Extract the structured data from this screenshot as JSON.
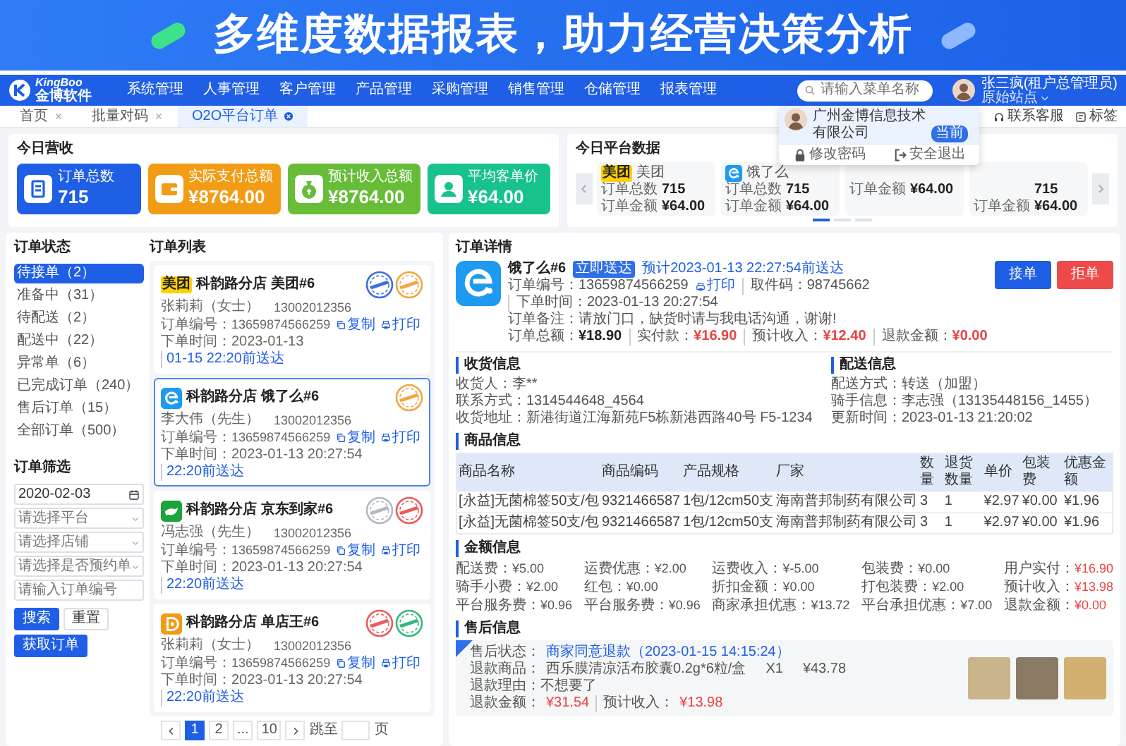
{
  "banner": {
    "title": "多维度数据报表，助力经营决策分析"
  },
  "nav": {
    "logo_name": "KingBoo",
    "logo_subtitle": "金博软件",
    "menus": [
      "系统管理",
      "人事管理",
      "客户管理",
      "产品管理",
      "采购管理",
      "销售管理",
      "仓储管理",
      "报表管理"
    ],
    "search": {
      "placeholder": "请输入菜单名称"
    },
    "user": {
      "name": "张三疯(租户总管理员)",
      "store": "原始站点"
    }
  },
  "tabs": [
    {
      "label": "首页",
      "selected": false
    },
    {
      "label": "批量对码",
      "selected": false
    },
    {
      "label": "O2O平台订单",
      "selected": true
    }
  ],
  "links": [
    {
      "kind": "service",
      "label": "联系客服"
    },
    {
      "kind": "tag",
      "label": "标签"
    }
  ],
  "user_menu": {
    "company": "广州金博信息技术有限公司",
    "badge": "当前",
    "actions": [
      {
        "kind": "password",
        "label": "修改密码"
      },
      {
        "kind": "logout",
        "label": "安全退出"
      }
    ]
  },
  "revenue": {
    "title": "今日营收",
    "cards": [
      {
        "kind": "orders",
        "label": "订单总数",
        "value": "715",
        "color": "#1f5fe6"
      },
      {
        "kind": "paid",
        "label": "实际支付总额",
        "value": "¥8764.00",
        "color": "#f29b14"
      },
      {
        "kind": "income",
        "label": "预计收入总额",
        "value": "¥8764.00",
        "color": "#67bd38"
      },
      {
        "kind": "average",
        "label": "平均客单价",
        "value": "¥64.00",
        "color": "#18c28c"
      }
    ]
  },
  "platforms": {
    "title": "今日平台数据",
    "cards": [
      {
        "kind": "meituan",
        "logo_text": "美团",
        "name": "美团",
        "count_label": "订单总数",
        "count": "715",
        "amount_label": "订单金额",
        "amount": "¥64.00"
      },
      {
        "kind": "eleme",
        "name": "饿了么",
        "count_label": "订单总数",
        "count": "715",
        "amount_label": "订单金额",
        "amount": "¥64.00"
      },
      {
        "amount_label": "订单金额",
        "amount": "¥64.00"
      },
      {
        "count": "715",
        "amount_label": "订单金额",
        "amount": "¥64.00"
      }
    ],
    "pages": [
      {
        "selected": true
      },
      {
        "selected": false
      },
      {
        "selected": false
      }
    ]
  },
  "order_status": {
    "title": "订单状态",
    "items": [
      {
        "label": "待接单（2）",
        "selected": true
      },
      {
        "label": "准备中（31）",
        "selected": false
      },
      {
        "label": "待配送（2）",
        "selected": false
      },
      {
        "label": "配送中（22）",
        "selected": false
      },
      {
        "label": "异常单（6）",
        "selected": false
      },
      {
        "label": "已完成订单（240）",
        "selected": false
      },
      {
        "label": "售后订单（15）",
        "selected": false
      },
      {
        "label": "全部订单（500）",
        "selected": false
      }
    ]
  },
  "filter": {
    "title": "订单筛选",
    "date": {
      "value": "2020-02-03"
    },
    "selects": [
      {
        "placeholder": "请选择平台"
      },
      {
        "placeholder": "请选择店铺"
      },
      {
        "placeholder": "请选择是否预约单"
      }
    ],
    "order_no": {
      "placeholder": "请输入订单编号"
    },
    "buttons": [
      {
        "kind": "primary",
        "label": "搜索"
      },
      {
        "kind": "plain",
        "label": "重置"
      },
      {
        "kind": "primary",
        "label": "获取订单"
      }
    ]
  },
  "orders": {
    "title": "订单列表",
    "items": [
      {
        "kind": "meituan",
        "logo_text": "美团",
        "store": "科韵路分店",
        "name": "美团#6",
        "customer": "张莉莉（女士）",
        "phone": "13002012356",
        "order_label": "订单编号：",
        "order_no": "13659874566259",
        "copy": "复制",
        "print": "打印",
        "time": "下单时间：2023-01-13",
        "eta": "01-15 22:20前送达",
        "stamps": [
          {
            "color": "#3d6fe0"
          },
          {
            "color": "#f2a640"
          }
        ],
        "selected": false
      },
      {
        "kind": "eleme",
        "store": "科韵路分店",
        "name": "饿了么#6",
        "customer": "李大伟（先生）",
        "phone": "13002012356",
        "order_label": "订单编号：",
        "order_no": "13659874566259",
        "copy": "复制",
        "print": "打印",
        "time": "下单时间：2023-01-13 20:27:54",
        "eta": "22:20前送达",
        "stamps": [
          {
            "color": "#f2a640"
          }
        ],
        "selected": true
      },
      {
        "kind": "jd",
        "store": "科韵路分店",
        "name": "京东到家#6",
        "customer": "冯志强（先生）",
        "phone": "13002012356",
        "order_label": "订单编号：",
        "order_no": "13659874566259",
        "copy": "复制",
        "print": "打印",
        "time": "下单时间：2023-01-13 20:27:54",
        "eta": "22:20前送达",
        "stamps": [
          {
            "color": "#b3b8c4"
          },
          {
            "color": "#ec5b5b"
          }
        ],
        "selected": false
      },
      {
        "kind": "shop",
        "store": "科韵路分店",
        "name": "单店王#6",
        "customer": "张莉莉（女士）",
        "phone": "13002012356",
        "order_label": "订单编号：",
        "order_no": "13659874566259",
        "copy": "复制",
        "print": "打印",
        "time": "下单时间：2023-01-13 20:27:54",
        "eta": "22:20前送达",
        "stamps": [
          {
            "color": "#ec5b5b"
          },
          {
            "color": "#35b878"
          }
        ],
        "selected": false
      }
    ],
    "pagination": {
      "pages": [
        {
          "label": "1",
          "selected": true
        },
        {
          "label": "2",
          "selected": false
        },
        {
          "label": "...",
          "selected": false
        },
        {
          "label": "10",
          "selected": false
        }
      ],
      "jump_label": "跳至",
      "unit": "页"
    }
  },
  "detail": {
    "title": "订单详情",
    "kind": "eleme",
    "name": "饿了么#6",
    "tag": "立即送达",
    "eta": "预计2023-01-13  22:27:54前送达",
    "order_no": "订单编号：13659874566259",
    "print": "打印",
    "pickup": "取件码：98745662",
    "order_time": "下单时间：2023-01-13 20:27:54",
    "remark": "订单备注：请放门口，缺货时请与我电话沟通，谢谢!",
    "totals": [
      {
        "label": "订单总额：",
        "value": "¥18.90",
        "highlight": false
      },
      {
        "label": "实付款：",
        "value": "¥16.90",
        "highlight": true
      },
      {
        "label": "预计收入：",
        "value": "¥12.40",
        "highlight": true
      },
      {
        "label": "退款金额：",
        "value": "¥0.00",
        "highlight": true
      }
    ],
    "buttons": [
      {
        "kind": "primary",
        "label": "接单"
      },
      {
        "kind": "danger",
        "label": "拒单"
      }
    ]
  },
  "receiver": {
    "title": "收货信息",
    "lines": [
      "收货人：李**",
      "联系方式：1314544648_4564",
      "收货地址：新港街道江海新苑F5栋新港西路40号 F5-1234"
    ]
  },
  "delivery": {
    "title": "配送信息",
    "lines": [
      "配送方式：转送（加盟）",
      "骑手信息：李志强（13135448156_1455）",
      "更新时间：2023-01-13 21:20:02"
    ]
  },
  "products": {
    "title": "商品信息",
    "columns": [
      "商品名称",
      "商品编码",
      "产品规格",
      "厂家",
      "数量",
      "退货数量",
      "单价",
      "包装费",
      "优惠金额"
    ],
    "rows": [
      [
        "[永益]无菌棉签50支/包",
        "9321466587",
        "1包/12cm50支",
        "海南普邦制药有限公司",
        "3",
        "1",
        "¥2.97",
        "¥0.00",
        "¥1.96"
      ],
      [
        "[永益]无菌棉签50支/包",
        "9321466587",
        "1包/12cm50支",
        "海南普邦制药有限公司",
        "3",
        "1",
        "¥2.97",
        "¥0.00",
        "¥1.96"
      ]
    ]
  },
  "amounts": {
    "title": "金额信息",
    "items": [
      {
        "label": "配送费：",
        "value": "¥5.00",
        "highlight": false
      },
      {
        "label": "运费优惠：",
        "value": "¥2.00",
        "highlight": false
      },
      {
        "label": "运费收入：",
        "value": "¥-5.00",
        "highlight": false
      },
      {
        "label": "包装费：",
        "value": "¥0.00",
        "highlight": false
      },
      {
        "label": "用户实付：",
        "value": "¥16.90",
        "highlight": true
      },
      {
        "label": "骑手小费：",
        "value": "¥2.00",
        "highlight": false
      },
      {
        "label": "红包：",
        "value": "¥0.00",
        "highlight": false
      },
      {
        "label": "折扣金额：",
        "value": "¥0.00",
        "highlight": false
      },
      {
        "label": "打包装费：",
        "value": "¥2.00",
        "highlight": false
      },
      {
        "label": "预计收入：",
        "value": "¥13.98",
        "highlight": true
      },
      {
        "label": "平台服务费：",
        "value": "¥0.96",
        "highlight": false
      },
      {
        "label": "平台服务费：",
        "value": "¥0.96",
        "highlight": false
      },
      {
        "label": "商家承担优惠：",
        "value": "¥13.72",
        "highlight": false
      },
      {
        "label": "平台承担优惠：",
        "value": "¥7.00",
        "highlight": false
      },
      {
        "label": "退款金额：",
        "value": "¥0.00",
        "highlight": true
      }
    ]
  },
  "after_sale": {
    "title": "售后信息",
    "status_label": "售后状态：",
    "status": "商家同意退款（2023-01-15 14:15:24）",
    "product_label": "退款商品：",
    "product": "西乐膜清凉活布胶囊0.2g*6粒/盒",
    "qty": "X1",
    "price": "¥43.78",
    "reason": "退款理由：不想要了",
    "refund_label": "退款金额：",
    "refund": "¥31.54",
    "income_label": "预计收入：",
    "income": "¥13.98",
    "photos": [
      {
        "kind": "photo"
      },
      {
        "kind": "photo"
      },
      {
        "kind": "photo"
      }
    ]
  }
}
